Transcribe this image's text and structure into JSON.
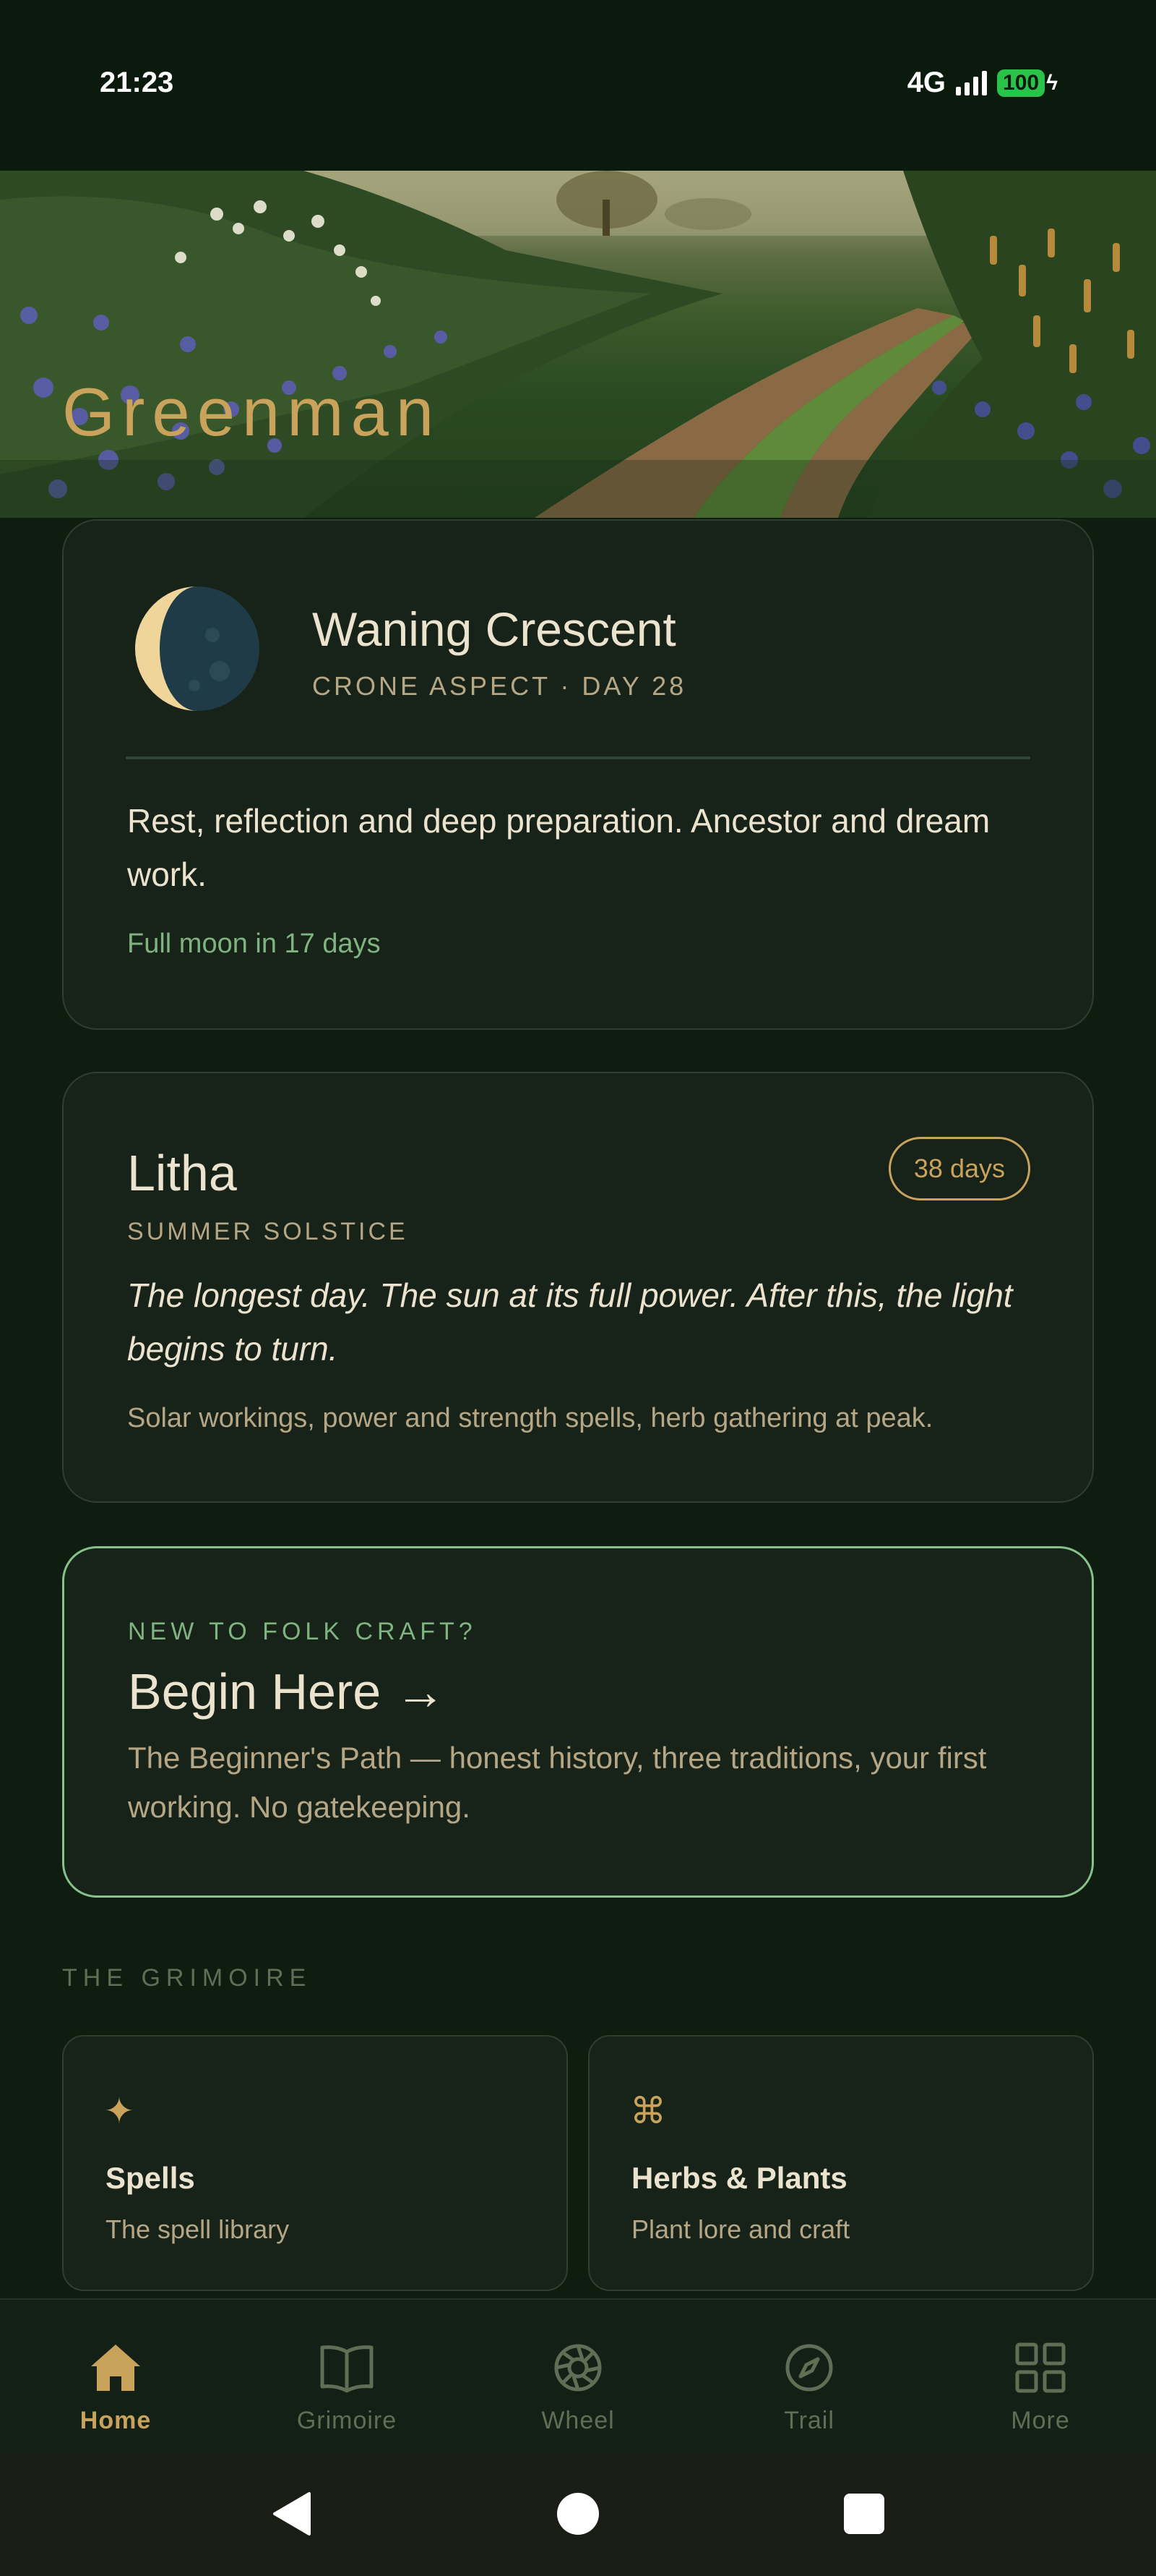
{
  "status_bar": {
    "time": "21:23",
    "network": "4G",
    "battery": "100"
  },
  "hero": {
    "title": "Greenman"
  },
  "moon_card": {
    "phase_name": "Waning Crescent",
    "phase_sub": "CRONE ASPECT · DAY 28",
    "description": "Rest, reflection and deep preparation. Ancestor and dream work.",
    "next_event": "Full moon in 17 days"
  },
  "sabbat_card": {
    "name": "Litha",
    "countdown": "38 days",
    "subtitle": "SUMMER SOLSTICE",
    "quote": "The longest day. The sun at its full power. After this, the light begins to turn.",
    "workings": "Solar workings, power and strength spells, herb gathering at peak."
  },
  "begin_card": {
    "eyebrow": "NEW TO FOLK CRAFT?",
    "title": "Begin Here →",
    "description": "The Beginner's Path — honest history, three traditions, your first working. No gatekeeping."
  },
  "grimoire": {
    "section_label": "THE GRIMOIRE",
    "tiles": [
      {
        "icon": "✦",
        "icon_name": "sparkle-icon",
        "title": "Spells",
        "subtitle": "The spell library"
      },
      {
        "icon": "⌘",
        "icon_name": "command-knot-icon",
        "title": "Herbs & Plants",
        "subtitle": "Plant lore and craft"
      }
    ]
  },
  "bottom_nav": {
    "items": [
      {
        "label": "Home",
        "icon": "home-icon",
        "active": true
      },
      {
        "label": "Grimoire",
        "icon": "book-icon",
        "active": false
      },
      {
        "label": "Wheel",
        "icon": "wheel-icon",
        "active": false
      },
      {
        "label": "Trail",
        "icon": "compass-icon",
        "active": false
      },
      {
        "label": "More",
        "icon": "grid-icon",
        "active": false
      }
    ]
  },
  "colors": {
    "background": "#0e1d10",
    "card": "#172218",
    "accent_gold": "#c9a25c",
    "accent_green": "#7fb380",
    "text_primary": "#ece3cf",
    "text_secondary": "#b5a786"
  }
}
